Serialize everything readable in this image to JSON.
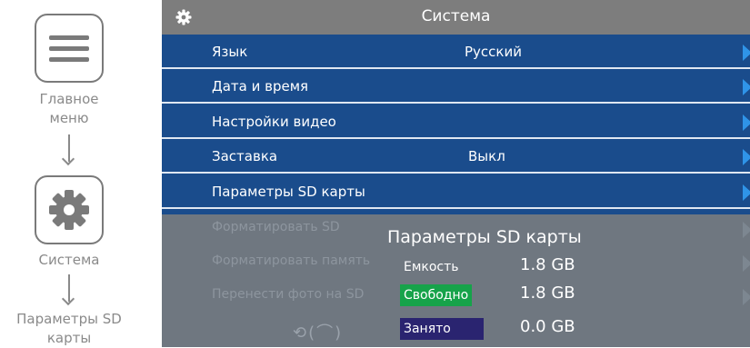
{
  "breadcrumb": {
    "main_menu_label_line1": "Главное",
    "main_menu_label_line2": "меню",
    "system_label": "Система",
    "sd_params_label_line1": "Параметры SD",
    "sd_params_label_line2": "карты"
  },
  "screen": {
    "title": "Система",
    "menu_items": [
      {
        "label": "Язык",
        "value": "Русский"
      },
      {
        "label": "Дата и время",
        "value": ""
      },
      {
        "label": "Настройки видео",
        "value": ""
      },
      {
        "label": "Заставка",
        "value": "Выкл"
      },
      {
        "label": "Параметры SD карты",
        "value": ""
      }
    ],
    "disabled_items": [
      {
        "label": "Форматировать SD"
      },
      {
        "label": "Форматировать память"
      },
      {
        "label": "Перенести фото на SD"
      }
    ],
    "sd_panel": {
      "title": "Параметры SD карты",
      "capacity_label": "Емкость",
      "capacity_value": "1.8 GB",
      "free_label": "Свободно",
      "free_value": "1.8 GB",
      "used_label": "Занято",
      "used_value": "0.0 GB",
      "back_hint": "⟲(⌒)"
    },
    "colors": {
      "menu_bg": "#1a4c8c",
      "title_bg": "#7d7d7d",
      "arrow": "#2f94e8",
      "free_badge": "#16a34a",
      "used_badge": "#2a2470"
    }
  }
}
